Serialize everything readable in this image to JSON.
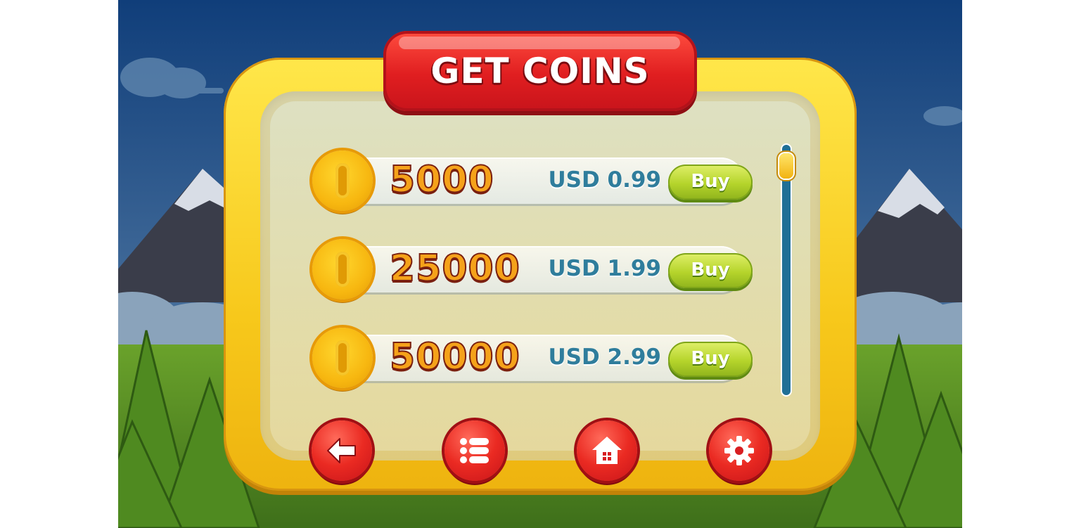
{
  "screen": {
    "title": "GET COINS"
  },
  "offers": [
    {
      "amount": "5000",
      "price": "USD 0.99",
      "button": "Buy"
    },
    {
      "amount": "25000",
      "price": "USD 1.99",
      "button": "Buy"
    },
    {
      "amount": "50000",
      "price": "USD 2.99",
      "button": "Buy"
    }
  ],
  "scrollbar": {
    "position": 0.0
  },
  "nav": [
    {
      "icon": "back-arrow-icon"
    },
    {
      "icon": "menu-list-icon"
    },
    {
      "icon": "home-icon"
    },
    {
      "icon": "gear-icon"
    }
  ],
  "colors": {
    "title_banner": "#e01e20",
    "frame": "#f7c81b",
    "buy_button": "#b5d42b",
    "price_text": "#2f7d9c",
    "amount_text": "#f5a21a"
  }
}
